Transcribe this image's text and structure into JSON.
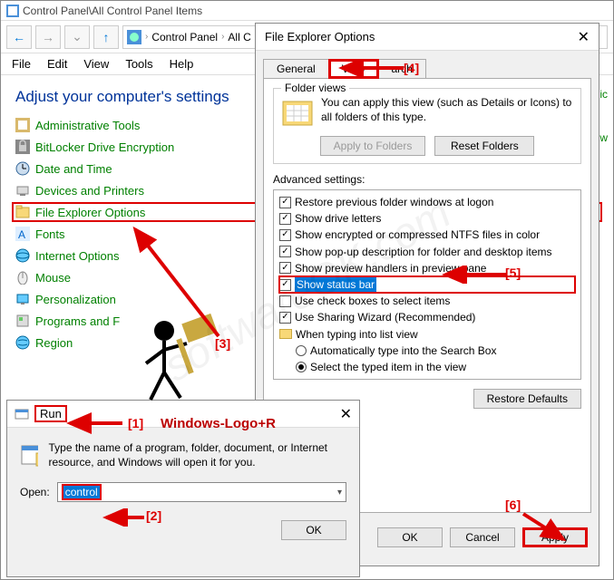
{
  "main": {
    "title": "Control Panel\\All Control Panel Items",
    "breadcrumb": [
      "Control Panel",
      "All C"
    ],
    "menus": [
      "File",
      "Edit",
      "View",
      "Tools",
      "Help"
    ],
    "heading": "Adjust your computer's settings",
    "items": [
      "Administrative Tools",
      "BitLocker Drive Encryption",
      "Date and Time",
      "Devices and Printers",
      "File Explorer Options",
      "Fonts",
      "Internet Options",
      "Mouse",
      "Personalization",
      "Programs and F",
      "Region"
    ],
    "right_links": [
      "ll ic",
      "dow"
    ]
  },
  "dlg": {
    "title": "File Explorer Options",
    "tabs": [
      "General",
      "View",
      "arch"
    ],
    "folder_views": {
      "label": "Folder views",
      "text": "You can apply this view (such as Details or Icons) to all folders of this type.",
      "apply_btn": "Apply to Folders",
      "reset_btn": "Reset Folders"
    },
    "advanced_label": "Advanced settings:",
    "adv": [
      {
        "type": "chk",
        "on": true,
        "label": "Restore previous folder windows at logon"
      },
      {
        "type": "chk",
        "on": true,
        "label": "Show drive letters"
      },
      {
        "type": "chk",
        "on": true,
        "label": "Show encrypted or compressed NTFS files in color"
      },
      {
        "type": "chk",
        "on": true,
        "label": "Show pop-up description for folder and desktop items"
      },
      {
        "type": "chk",
        "on": true,
        "label": "Show preview handlers in preview pane"
      },
      {
        "type": "chk",
        "on": true,
        "label": "Show status bar",
        "hl": true
      },
      {
        "type": "chk",
        "on": false,
        "label": "Use check boxes to select items"
      },
      {
        "type": "chk",
        "on": true,
        "label": "Use Sharing Wizard (Recommended)"
      },
      {
        "type": "folder",
        "label": "When typing into list view"
      },
      {
        "type": "radio",
        "on": false,
        "label": "Automatically type into the Search Box",
        "indent": true
      },
      {
        "type": "radio",
        "on": true,
        "label": "Select the typed item in the view",
        "indent": true
      }
    ],
    "restore_btn": "Restore Defaults",
    "ok": "OK",
    "cancel": "Cancel",
    "apply": "Apply"
  },
  "run": {
    "title": "Run",
    "desc": "Type the name of a program, folder, document, or Internet resource, and Windows will open it for you.",
    "open_label": "Open:",
    "value": "control",
    "ok": "OK"
  },
  "annotations": {
    "c1": "[1]",
    "c2": "[2]",
    "c3": "[3]",
    "c4": "[4]",
    "c5": "[5]",
    "c6": "[6]",
    "kbd": "Windows-Logo+R"
  }
}
